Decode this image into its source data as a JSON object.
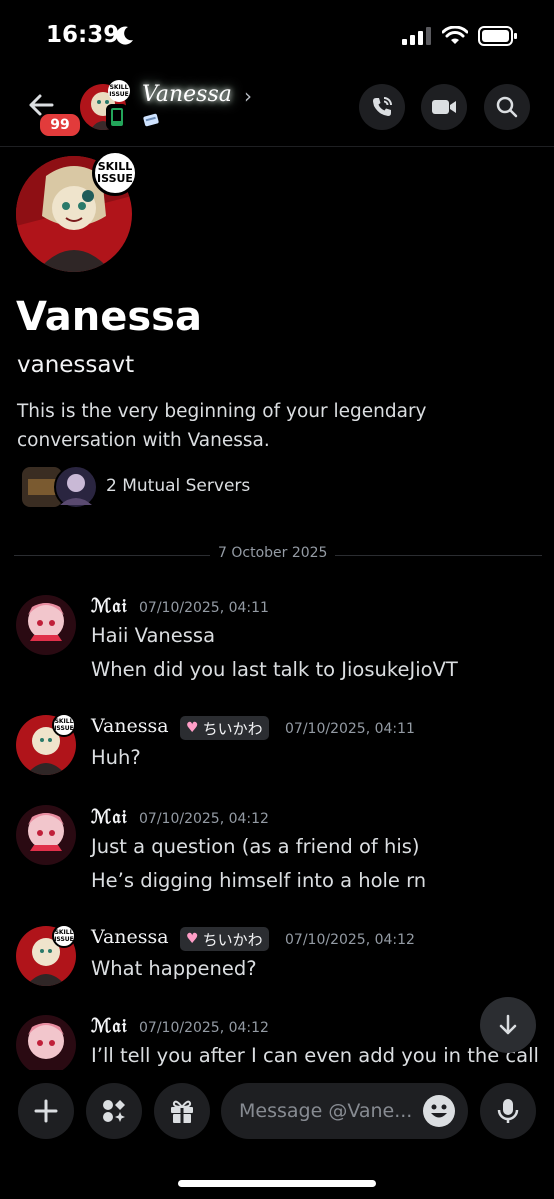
{
  "status_bar": {
    "time": "16:39"
  },
  "header": {
    "unread_badge": "99",
    "contact_name": "Vanessa",
    "avatar_badge": "SKILL ISSUE",
    "chevron": "›"
  },
  "profile": {
    "display_name": "Vanessa",
    "username": "vanessavt",
    "intro": "This is the very beginning of your legendary conversation with Vanessa.",
    "mutual_servers": "2 Mutual Servers",
    "avatar_badge": "SKILL ISSUE"
  },
  "divider": {
    "date": "7 October 2025"
  },
  "messages": [
    {
      "author": "ℳ𝔞𝔦",
      "timestamp": "07/10/2025, 04:11",
      "lines": [
        "Haii Vanessa",
        "When did you last talk to JiosukeJioVT"
      ]
    },
    {
      "author": "Vanessa",
      "tag": "ちいかわ",
      "timestamp": "07/10/2025, 04:11",
      "lines": [
        "Huh?"
      ]
    },
    {
      "author": "ℳ𝔞𝔦",
      "timestamp": "07/10/2025, 04:12",
      "lines": [
        "Just a question (as a friend of his)",
        "He’s digging himself into a hole rn"
      ]
    },
    {
      "author": "Vanessa",
      "tag": "ちいかわ",
      "timestamp": "07/10/2025, 04:12",
      "lines": [
        "What happened?"
      ]
    },
    {
      "author": "ℳ𝔞𝔦",
      "timestamp": "07/10/2025, 04:12",
      "lines": [
        "I’ll tell you after I can even add you in the call"
      ]
    }
  ],
  "composer": {
    "placeholder": "Message @Vane..."
  },
  "colors": {
    "background": "#000000",
    "surface": "#1e1f22",
    "badge": "#e23b3b",
    "muted": "#949ba4"
  }
}
